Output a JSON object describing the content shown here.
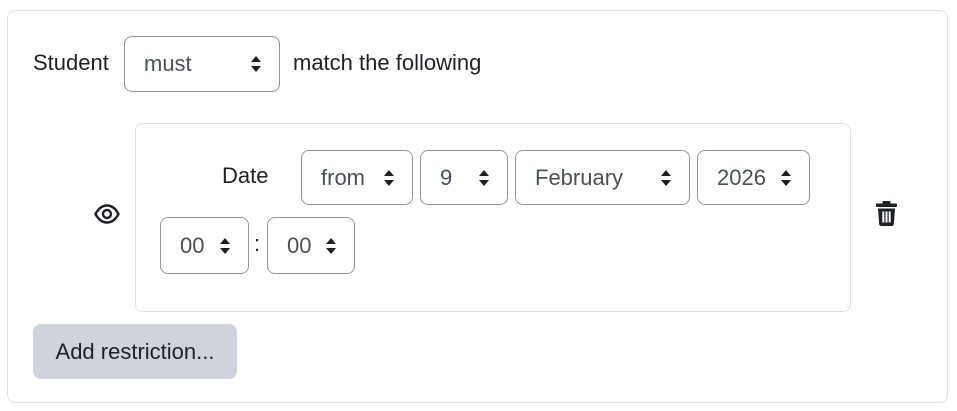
{
  "restriction_set": {
    "prefix_label": "Student",
    "match_mode": {
      "selected": "must"
    },
    "suffix_label": "match the following"
  },
  "date_condition": {
    "label": "Date",
    "direction": {
      "selected": "from"
    },
    "day": {
      "selected": "9"
    },
    "month": {
      "selected": "February"
    },
    "year": {
      "selected": "2026"
    },
    "hour": {
      "selected": "00"
    },
    "time_separator": ":",
    "minute": {
      "selected": "00"
    },
    "visibility_icon": "eye-icon",
    "delete_icon": "trash-icon"
  },
  "add_restriction_button": {
    "label": "Add restriction..."
  }
}
